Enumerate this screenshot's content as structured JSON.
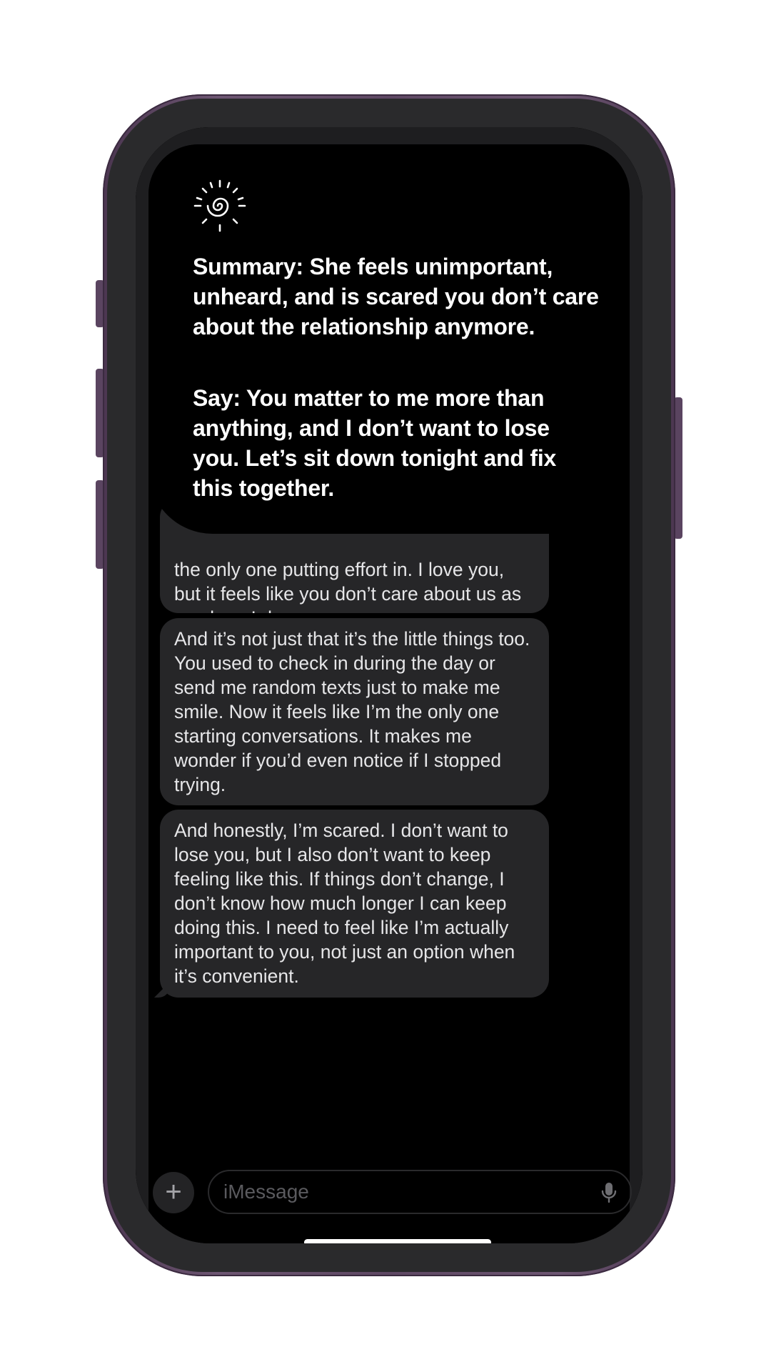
{
  "overlay": {
    "icon": "sun-spiral-icon",
    "summary_text": "Summary: She feels unimportant, unheard, and is scared you don’t care about the relationship anymore.",
    "say_text": "Say: You matter to me more than anything, and I don’t want to lose you. Let’s sit down tonight and fix this together."
  },
  "messages": [
    {
      "text": "the only one putting effort in. I love you, but it feels like you don’t care about us as much as I do."
    },
    {
      "text": "And it’s not just that it’s the little things too. You used to check in during the day or send me random texts just to make me smile. Now it feels like I’m the only one starting conversations. It makes me wonder if you’d even notice if I stopped trying."
    },
    {
      "text": "And honestly, I’m scared. I don’t want to lose you, but I also don’t want to keep feeling like this. If things don’t change, I don’t know how much longer I can keep doing this. I need to feel like I’m actually important to you, not just an option when it’s convenient."
    }
  ],
  "composer": {
    "plus_label": "+",
    "placeholder": "iMessage",
    "mic_icon": "microphone-icon"
  },
  "colors": {
    "frame": "#5e4863",
    "bubble": "#262628",
    "screen": "#000000"
  }
}
